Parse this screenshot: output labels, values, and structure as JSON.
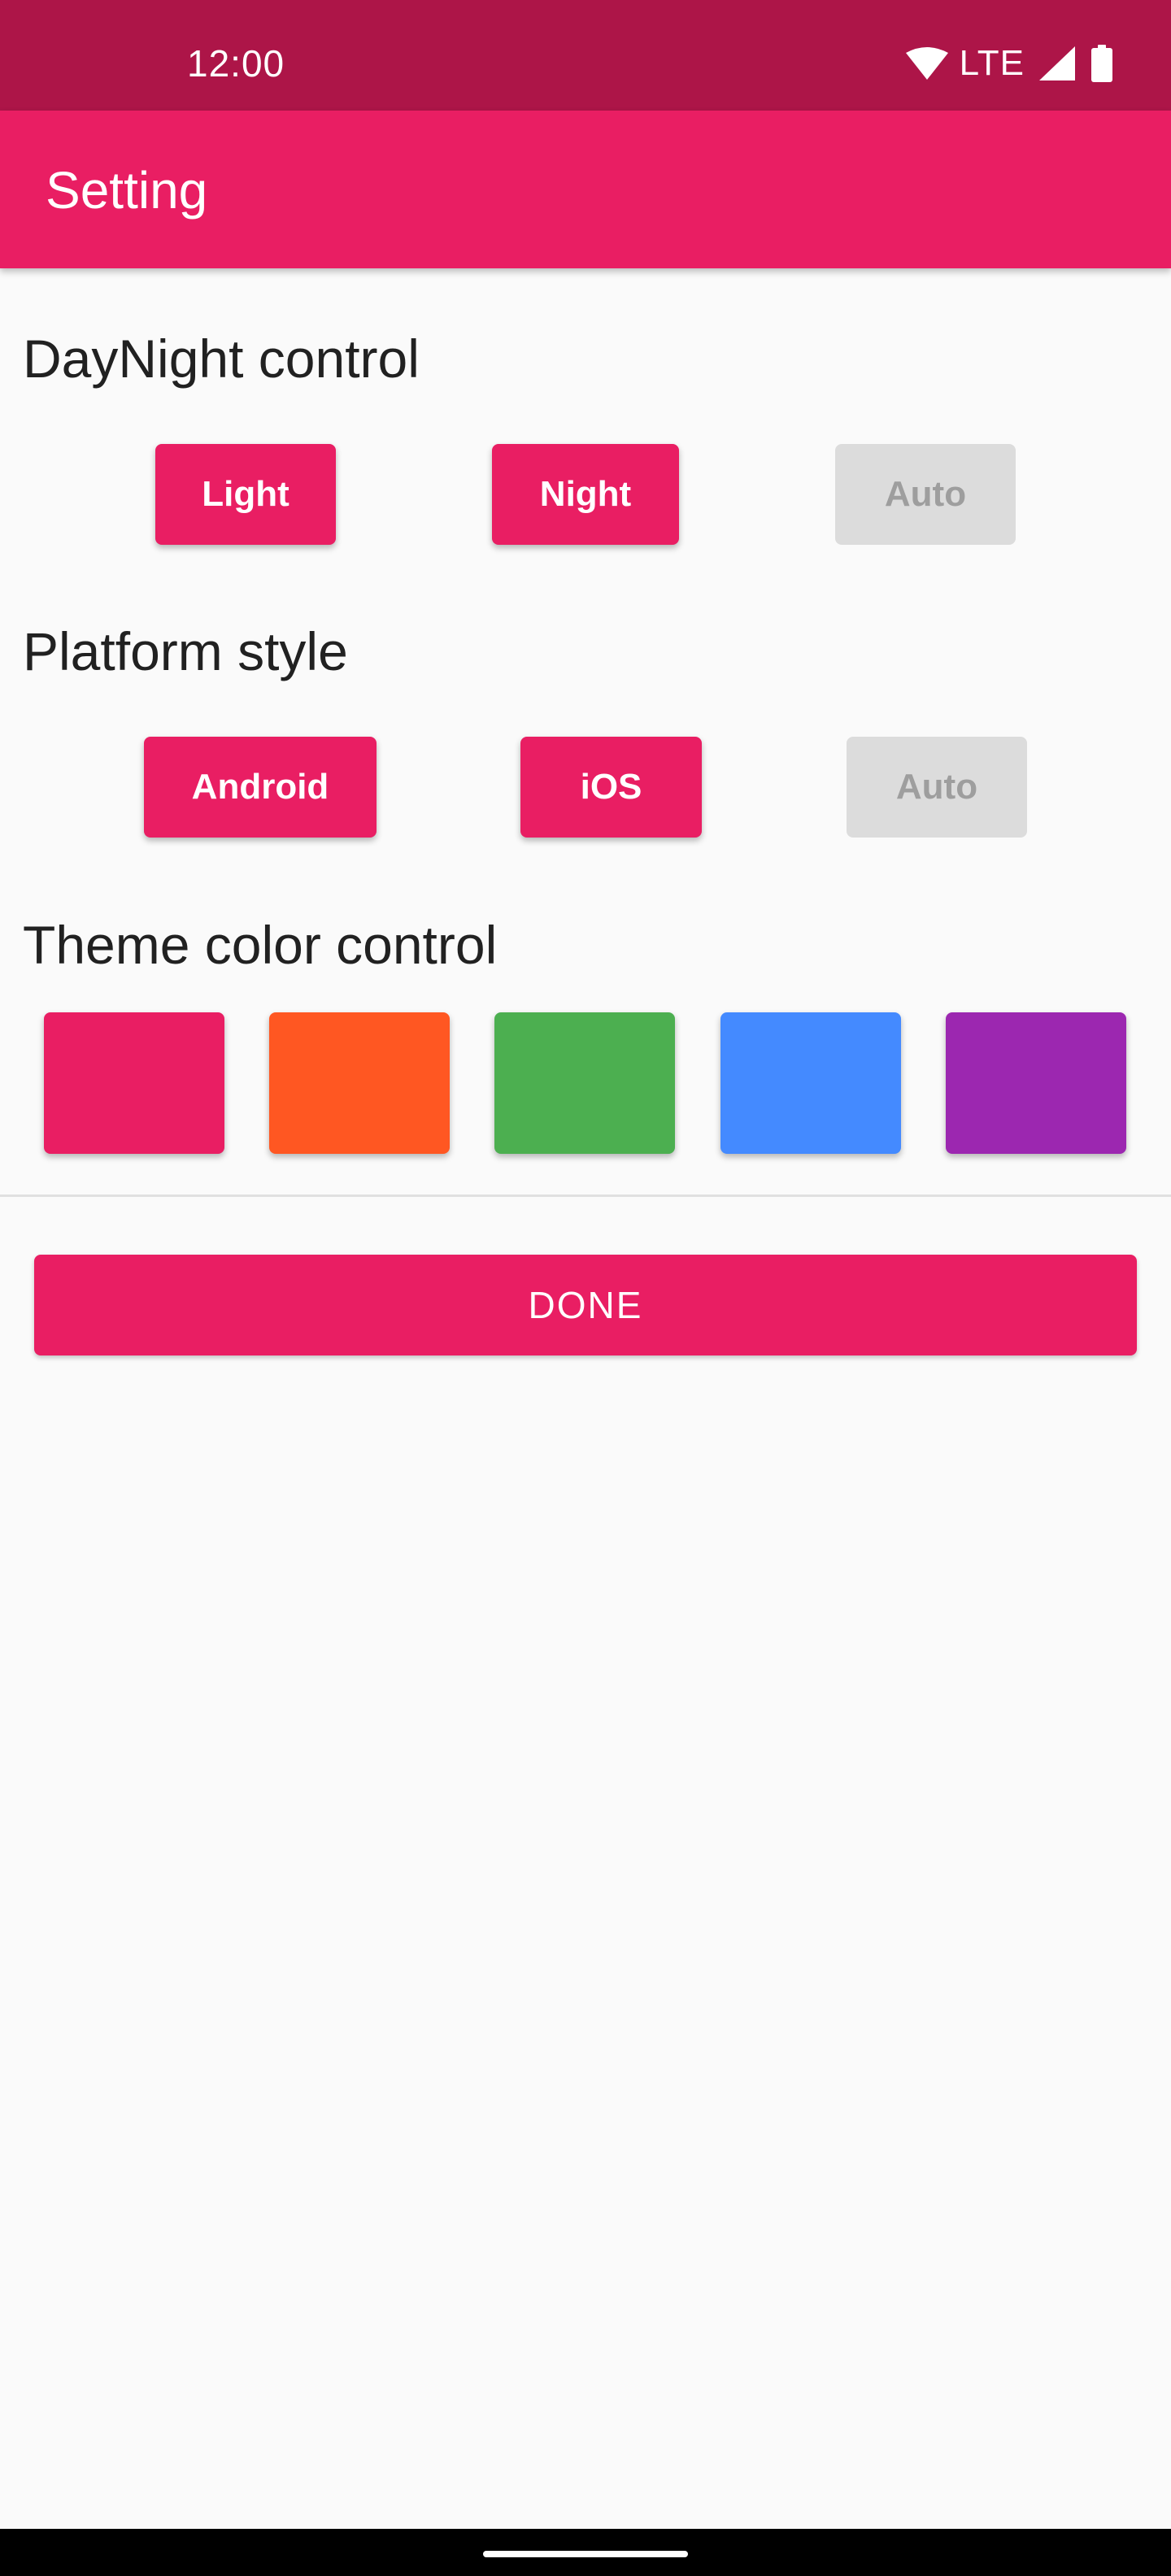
{
  "status_bar": {
    "time": "12:00",
    "network": "LTE",
    "icons": [
      "wifi-icon",
      "signal-icon",
      "battery-icon"
    ],
    "color": "#ad1548"
  },
  "app_bar": {
    "title": "Setting",
    "color": "#e91e63"
  },
  "daynight": {
    "title": "DayNight control",
    "buttons": [
      {
        "label": "Light",
        "enabled": true
      },
      {
        "label": "Night",
        "enabled": true
      },
      {
        "label": "Auto",
        "enabled": false
      }
    ]
  },
  "platform": {
    "title": "Platform style",
    "buttons": [
      {
        "label": "Android",
        "enabled": true
      },
      {
        "label": "iOS",
        "enabled": true
      },
      {
        "label": "Auto",
        "enabled": false
      }
    ]
  },
  "theme": {
    "title": "Theme color control",
    "colors": [
      {
        "name": "pink",
        "hex": "#e91e63"
      },
      {
        "name": "orange",
        "hex": "#ff5722"
      },
      {
        "name": "green",
        "hex": "#4caf50"
      },
      {
        "name": "blue",
        "hex": "#448aff"
      },
      {
        "name": "purple",
        "hex": "#9c27b0"
      }
    ]
  },
  "done_button": {
    "label": "DONE"
  }
}
